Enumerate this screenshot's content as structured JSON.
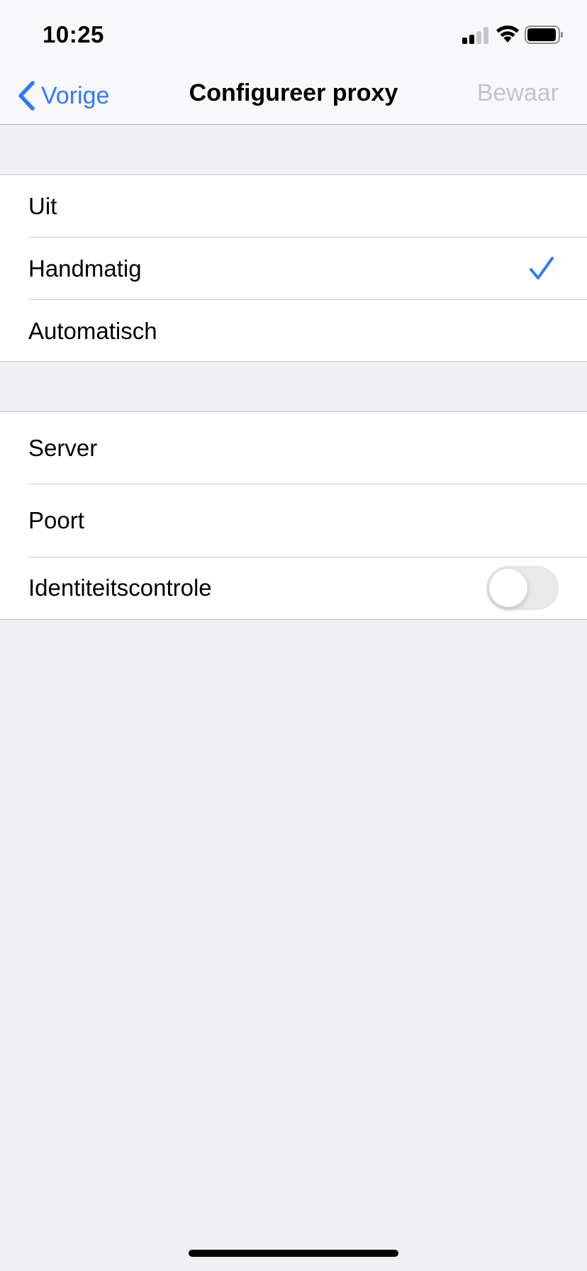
{
  "status_bar": {
    "time": "10:25"
  },
  "nav": {
    "back_label": "Vorige",
    "title": "Configureer proxy",
    "save_label": "Bewaar"
  },
  "proxy_mode": {
    "options": [
      {
        "label": "Uit",
        "selected": false
      },
      {
        "label": "Handmatig",
        "selected": true
      },
      {
        "label": "Automatisch",
        "selected": false
      }
    ]
  },
  "manual_settings": {
    "server_label": "Server",
    "port_label": "Poort",
    "auth_label": "Identiteitscontrole",
    "auth_enabled": false
  },
  "colors": {
    "accent": "#3478f6",
    "disabled": "#c4c4c6",
    "background": "#efeff4"
  },
  "icons": {
    "back": "chevron-left-icon",
    "selected": "checkmark-icon",
    "signal": "cellular-signal-icon",
    "wifi": "wifi-icon",
    "battery": "battery-icon"
  }
}
